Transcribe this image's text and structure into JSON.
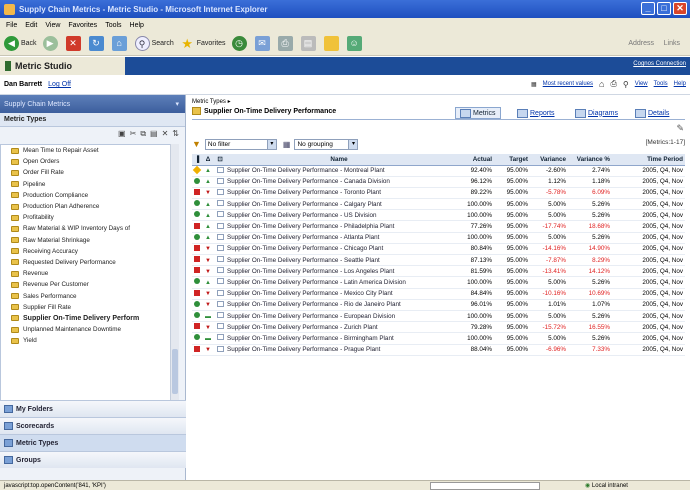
{
  "window": {
    "title": "Supply Chain Metrics - Metric Studio - Microsoft Internet Explorer"
  },
  "menu": [
    "File",
    "Edit",
    "View",
    "Favorites",
    "Tools",
    "Help"
  ],
  "toolbar": {
    "back": "Back",
    "search": "Search",
    "favorites": "Favorites",
    "address": "Address",
    "links": "Links"
  },
  "app": {
    "name": "Metric Studio",
    "cognos_link": "Cognos Connection"
  },
  "userbar": {
    "user": "Dan Barrett",
    "logoff": "Log Off",
    "recent": "Most recent values",
    "view": "View",
    "tools": "Tools",
    "help": "Help"
  },
  "left": {
    "panel_title": "Supply Chain Metrics",
    "section_title": "Metric Types",
    "items": [
      "Mean Time to Repair Asset",
      "Open Orders",
      "Order Fill Rate",
      "Pipeline",
      "Production Compliance",
      "Production Plan Adherence",
      "Profitability",
      "Raw Material & WIP Inventory Days of",
      "Raw Material Shrinkage",
      "Receiving Accuracy",
      "Requested Delivery Performance",
      "Revenue",
      "Revenue Per Customer",
      "Sales Performance",
      "Supplier Fill Rate",
      "Supplier On-Time Delivery Perform",
      "Unplanned Maintenance Downtime",
      "Yield"
    ],
    "nav": [
      "My Folders",
      "Scorecards",
      "Metric Types",
      "Groups"
    ]
  },
  "main": {
    "crumb": "Metric Types",
    "title": "Supplier On-Time Delivery Performance",
    "tabs": [
      "Metrics",
      "Reports",
      "Diagrams",
      "Details"
    ],
    "filter": "No filter",
    "grouping": "No grouping",
    "count": "[Metrics:1-17]",
    "columns": [
      "Name",
      "Actual",
      "Target",
      "Variance",
      "Variance %",
      "Time Period"
    ],
    "rows": [
      {
        "status": "yellow",
        "trend": "up",
        "name": "Supplier On-Time Delivery Performance - Montreal Plant",
        "actual": "92.40%",
        "target": "95.00%",
        "variance": "-2.60%",
        "vpct": "2.74%",
        "period": "2005, Q4, Nov",
        "neg": false
      },
      {
        "status": "green",
        "trend": "up",
        "name": "Supplier On-Time Delivery Performance - Canada Division",
        "actual": "96.12%",
        "target": "95.00%",
        "variance": "1.12%",
        "vpct": "1.18%",
        "period": "2005, Q4, Nov",
        "neg": false
      },
      {
        "status": "red",
        "trend": "down",
        "name": "Supplier On-Time Delivery Performance - Toronto Plant",
        "actual": "89.22%",
        "target": "95.00%",
        "variance": "-5.78%",
        "vpct": "6.09%",
        "period": "2005, Q4, Nov",
        "neg": true
      },
      {
        "status": "green",
        "trend": "up",
        "name": "Supplier On-Time Delivery Performance - Calgary Plant",
        "actual": "100.00%",
        "target": "95.00%",
        "variance": "5.00%",
        "vpct": "5.26%",
        "period": "2005, Q4, Nov",
        "neg": false
      },
      {
        "status": "green",
        "trend": "up",
        "name": "Supplier On-Time Delivery Performance - US Division",
        "actual": "100.00%",
        "target": "95.00%",
        "variance": "5.00%",
        "vpct": "5.26%",
        "period": "2005, Q4, Nov",
        "neg": false
      },
      {
        "status": "red",
        "trend": "up",
        "name": "Supplier On-Time Delivery Performance - Philadelphia Plant",
        "actual": "77.26%",
        "target": "95.00%",
        "variance": "-17.74%",
        "vpct": "18.68%",
        "period": "2005, Q4, Nov",
        "neg": true
      },
      {
        "status": "green",
        "trend": "up",
        "name": "Supplier On-Time Delivery Performance - Atlanta Plant",
        "actual": "100.00%",
        "target": "95.00%",
        "variance": "5.00%",
        "vpct": "5.26%",
        "period": "2005, Q4, Nov",
        "neg": false
      },
      {
        "status": "red",
        "trend": "down",
        "name": "Supplier On-Time Delivery Performance - Chicago Plant",
        "actual": "80.84%",
        "target": "95.00%",
        "variance": "-14.16%",
        "vpct": "14.90%",
        "period": "2005, Q4, Nov",
        "neg": true
      },
      {
        "status": "red",
        "trend": "down",
        "name": "Supplier On-Time Delivery Performance - Seattle Plant",
        "actual": "87.13%",
        "target": "95.00%",
        "variance": "-7.87%",
        "vpct": "8.29%",
        "period": "2005, Q4, Nov",
        "neg": true
      },
      {
        "status": "red",
        "trend": "down",
        "name": "Supplier On-Time Delivery Performance - Los Angeles Plant",
        "actual": "81.59%",
        "target": "95.00%",
        "variance": "-13.41%",
        "vpct": "14.12%",
        "period": "2005, Q4, Nov",
        "neg": true
      },
      {
        "status": "green",
        "trend": "up",
        "name": "Supplier On-Time Delivery Performance - Latin America Division",
        "actual": "100.00%",
        "target": "95.00%",
        "variance": "5.00%",
        "vpct": "5.26%",
        "period": "2005, Q4, Nov",
        "neg": false
      },
      {
        "status": "red",
        "trend": "down",
        "name": "Supplier On-Time Delivery Performance - Mexico City Plant",
        "actual": "84.84%",
        "target": "95.00%",
        "variance": "-10.16%",
        "vpct": "10.69%",
        "period": "2005, Q4, Nov",
        "neg": true
      },
      {
        "status": "green",
        "trend": "down",
        "name": "Supplier On-Time Delivery Performance - Rio de Janeiro Plant",
        "actual": "96.01%",
        "target": "95.00%",
        "variance": "1.01%",
        "vpct": "1.07%",
        "period": "2005, Q4, Nov",
        "neg": false
      },
      {
        "status": "green",
        "trend": "flat",
        "name": "Supplier On-Time Delivery Performance - European Division",
        "actual": "100.00%",
        "target": "95.00%",
        "variance": "5.00%",
        "vpct": "5.26%",
        "period": "2005, Q4, Nov",
        "neg": false
      },
      {
        "status": "red",
        "trend": "down",
        "name": "Supplier On-Time Delivery Performance - Zurich Plant",
        "actual": "79.28%",
        "target": "95.00%",
        "variance": "-15.72%",
        "vpct": "16.55%",
        "period": "2005, Q4, Nov",
        "neg": true
      },
      {
        "status": "green",
        "trend": "flat",
        "name": "Supplier On-Time Delivery Performance - Birmingham Plant",
        "actual": "100.00%",
        "target": "95.00%",
        "variance": "5.00%",
        "vpct": "5.26%",
        "period": "2005, Q4, Nov",
        "neg": false
      },
      {
        "status": "red",
        "trend": "down",
        "name": "Supplier On-Time Delivery Performance - Prague Plant",
        "actual": "88.04%",
        "target": "95.00%",
        "variance": "-6.96%",
        "vpct": "7.33%",
        "period": "2005, Q4, Nov",
        "neg": true
      }
    ]
  },
  "status": {
    "url": "javascript:top.openContent('841, 'KPI')",
    "zone": "Local intranet"
  },
  "colors": {
    "appbar": "#1c4c98",
    "negative": "#e02020",
    "green": "#2f8f3a",
    "red": "#d02424",
    "yellow": "#f0b000"
  }
}
